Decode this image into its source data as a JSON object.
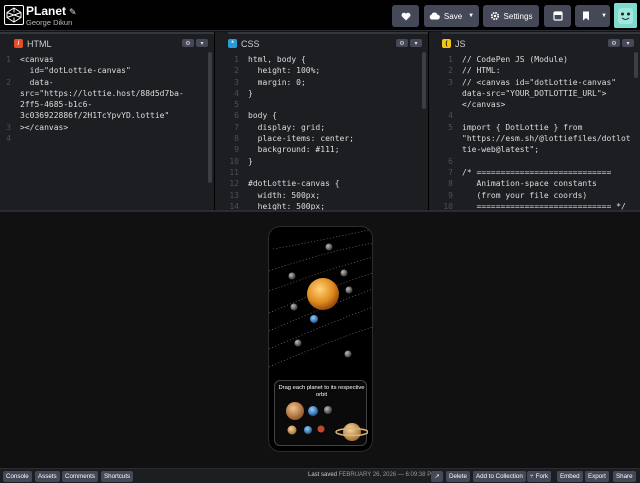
{
  "header": {
    "title": "PLanet",
    "author": "George Dikun",
    "save_label": "Save",
    "settings_label": "Settings"
  },
  "editors": {
    "html": {
      "label": "HTML",
      "lines": [
        {
          "n": "1",
          "t": "<canvas"
        },
        {
          "n": "",
          "t": "  id=\"dotLottie-canvas\""
        },
        {
          "n": "2",
          "t": "  data-"
        },
        {
          "n": "",
          "t": "src=\"https://lottie.host/88d5d7ba-"
        },
        {
          "n": "",
          "t": "2ff5-4685-b1c6-"
        },
        {
          "n": "",
          "t": "3c036922886f/2H1TcYpvYD.lottie\""
        },
        {
          "n": "3",
          "t": "></canvas>"
        },
        {
          "n": "4",
          "t": ""
        }
      ]
    },
    "css": {
      "label": "CSS",
      "lines": [
        {
          "n": "1",
          "t": "html, body {"
        },
        {
          "n": "2",
          "t": "  height: 100%;"
        },
        {
          "n": "3",
          "t": "  margin: 0;"
        },
        {
          "n": "4",
          "t": "}"
        },
        {
          "n": "5",
          "t": ""
        },
        {
          "n": "6",
          "t": "body {"
        },
        {
          "n": "7",
          "t": "  display: grid;"
        },
        {
          "n": "8",
          "t": "  place-items: center;"
        },
        {
          "n": "9",
          "t": "  background: #111;"
        },
        {
          "n": "10",
          "t": "}"
        },
        {
          "n": "11",
          "t": ""
        },
        {
          "n": "12",
          "t": "#dotLottie-canvas {"
        },
        {
          "n": "13",
          "t": "  width: 500px;"
        },
        {
          "n": "14",
          "t": "  height: 500px;"
        }
      ]
    },
    "js": {
      "label": "JS",
      "lines": [
        {
          "n": "1",
          "t": "// CodePen JS (Module)"
        },
        {
          "n": "2",
          "t": "// HTML:"
        },
        {
          "n": "3",
          "t": "// <canvas id=\"dotLottie-canvas\""
        },
        {
          "n": "",
          "t": "data-src=\"YOUR_DOTLOTTIE_URL\">"
        },
        {
          "n": "",
          "t": "</canvas>"
        },
        {
          "n": "4",
          "t": ""
        },
        {
          "n": "5",
          "t": "import { DotLottie } from"
        },
        {
          "n": "",
          "t": "\"https://esm.sh/@lottiefiles/dotlot"
        },
        {
          "n": "",
          "t": "tie-web@latest\";"
        },
        {
          "n": "6",
          "t": ""
        },
        {
          "n": "7",
          "t": "/* ============================"
        },
        {
          "n": "8",
          "t": "   Animation-space constants"
        },
        {
          "n": "9",
          "t": "   (from your file coords)"
        },
        {
          "n": "10",
          "t": "   ============================ */"
        }
      ]
    }
  },
  "preview": {
    "instruction": "Drag each planet to its respective orbit"
  },
  "footer": {
    "console": "Console",
    "assets": "Assets",
    "comments": "Comments",
    "shortcuts": "Shortcuts",
    "saved_prefix": "Last saved",
    "saved_date": "FEBRUARY 26, 2026 — 6:09:38 PM",
    "delete": "Delete",
    "add_collection": "Add to Collection",
    "fork": "Fork",
    "embed": "Embed",
    "export": "Export",
    "share": "Share"
  },
  "colors": {
    "accent_green": "#47cf73",
    "html_icon": "#e44d26",
    "css_icon": "#2b9bd8",
    "js_icon": "#f0c419"
  }
}
